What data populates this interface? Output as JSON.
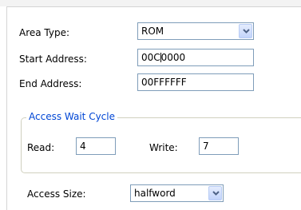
{
  "form": {
    "area_type": {
      "label": "Area Type:",
      "value": "ROM",
      "icon": "chevron-down-icon"
    },
    "start_address": {
      "label": "Start Address:",
      "value_before_cursor": "00C",
      "value_after_cursor": "0000"
    },
    "end_address": {
      "label": "End Address:",
      "value": "00FFFFFF"
    },
    "access_wait_cycle": {
      "legend": "Access Wait Cycle",
      "read_label": "Read:",
      "read_value": "4",
      "write_label": "Write:",
      "write_value": "7"
    },
    "access_size": {
      "label": "Access Size:",
      "value": "halfword",
      "icon": "chevron-down-icon"
    }
  },
  "colors": {
    "field_border": "#7f9db9",
    "group_legend": "#0046d5",
    "group_border": "#d0d0bf",
    "dropdown_arrow": "#4d6185"
  }
}
